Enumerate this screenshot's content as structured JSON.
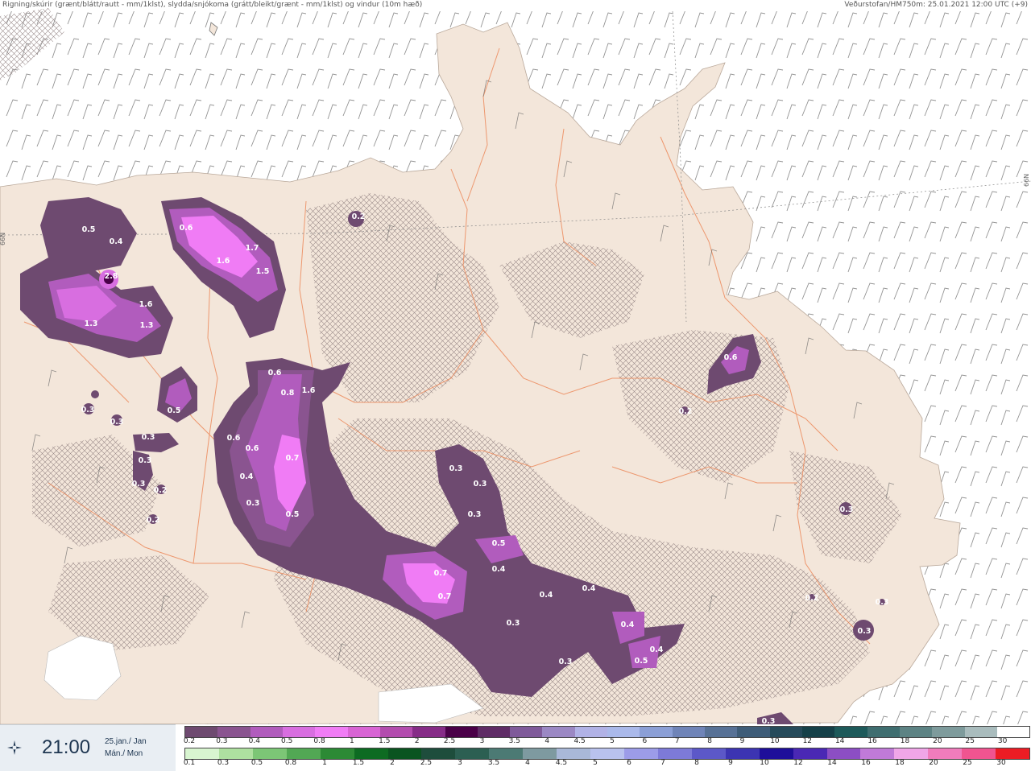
{
  "header": {
    "left": "Rigning/skúrir (grænt/blátt/rautt - mm/1klst), slydda/snjókoma (grátt/bleikt/grænt - mm/1klst) og vindur (10m hæð)",
    "right": "Veðurstofan/HM750m: 25.01.2021 12:00 UTC (+9)"
  },
  "lat_label": "66N",
  "time": {
    "value": "21:00",
    "date_line1": "25.jan./ Jan",
    "date_line2": "Mán./ Mon",
    "icon": "crosshair-star-icon"
  },
  "precip_labels": [
    "0.5",
    "0.4",
    "2.8",
    "1.6",
    "1.3",
    "1.3",
    "0.6",
    "1.7",
    "1.6",
    "1.5",
    "0.2",
    "0.6",
    "0.8",
    "1.6",
    "0.5",
    "0.3",
    "0.3",
    "0.6",
    "0.6",
    "0.4",
    "0.7",
    "0.3",
    "0.5",
    "0.3",
    "0.3",
    "0.3",
    "0.3",
    "0.2",
    "0.2",
    "0.3",
    "0.3",
    "0.3",
    "0.5",
    "0.4",
    "0.7",
    "0.7",
    "0.4",
    "0.4",
    "0.3",
    "0.4",
    "0.4",
    "0.5",
    "0.3",
    "0.6",
    "0.3",
    "0.3",
    "0.2",
    "0.2",
    "0.3"
  ],
  "legend_snow": {
    "ticks": [
      "0.2",
      "0.3",
      "0.4",
      "0.5",
      "0.8",
      "1",
      "1.5",
      "2",
      "2.5",
      "3",
      "3.5",
      "4",
      "4.5",
      "5",
      "6",
      "7",
      "8",
      "9",
      "10",
      "12",
      "14",
      "16",
      "18",
      "20",
      "25",
      "30"
    ],
    "colors": [
      "#6e4a70",
      "#8a5490",
      "#b15cbd",
      "#d86ee0",
      "#f07cf5",
      "#d864d4",
      "#b34cae",
      "#862c87",
      "#4a0048",
      "#5f2c66",
      "#7f5a9a",
      "#9b88c4",
      "#b1b2e6",
      "#aab9ea",
      "#8b9fd6",
      "#6f84b8",
      "#577196",
      "#3e5c78",
      "#264a5a",
      "#154048",
      "#1d5a5a",
      "#3f6e70",
      "#5d8384",
      "#7e9b9c",
      "#a9bcbd",
      "#ffffff"
    ]
  },
  "legend_rain": {
    "ticks": [
      "0.1",
      "0.3",
      "0.5",
      "0.8",
      "1",
      "1.5",
      "2",
      "2.5",
      "3",
      "3.5",
      "4",
      "4.5",
      "5",
      "6",
      "7",
      "8",
      "9",
      "10",
      "12",
      "14",
      "16",
      "18",
      "20",
      "25",
      "30"
    ],
    "colors": [
      "#d8f5d0",
      "#aee0a0",
      "#7cc676",
      "#52a854",
      "#2c8a35",
      "#0d6b22",
      "#0a5420",
      "#1e4d3c",
      "#2c5f52",
      "#4c7a74",
      "#7e9aa0",
      "#a9b8d8",
      "#b9c2ee",
      "#9c9ce8",
      "#7d7ad8",
      "#5c58c8",
      "#3c34b2",
      "#1e0e9a",
      "#4a28b4",
      "#8c4ec4",
      "#c07ad8",
      "#f0a6e8",
      "#f07cbc",
      "#f05490",
      "#ec1c24"
    ]
  },
  "colors": {
    "land": "#f3e6da",
    "sea": "#ffffff",
    "roads": "#ec8a5c",
    "hatch": "#9a8a8a"
  }
}
